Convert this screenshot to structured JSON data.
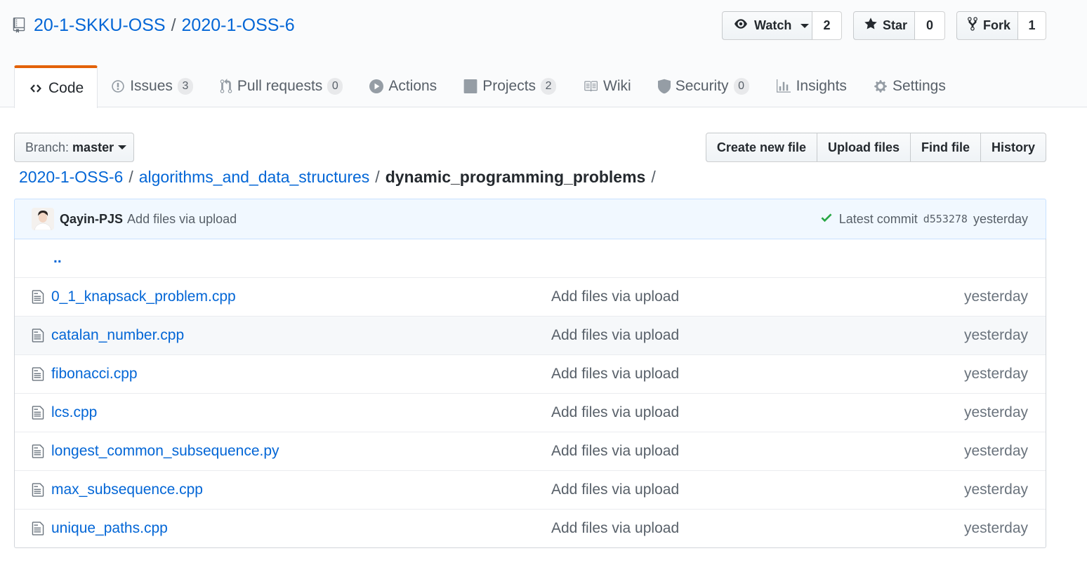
{
  "repo": {
    "owner": "20-1-SKKU-OSS",
    "separator": "/",
    "name": "2020-1-OSS-6"
  },
  "actions": {
    "watch": {
      "label": "Watch",
      "count": "2"
    },
    "star": {
      "label": "Star",
      "count": "0"
    },
    "fork": {
      "label": "Fork",
      "count": "1"
    }
  },
  "nav": {
    "code": {
      "label": "Code"
    },
    "issues": {
      "label": "Issues",
      "count": "3"
    },
    "pulls": {
      "label": "Pull requests",
      "count": "0"
    },
    "actions": {
      "label": "Actions"
    },
    "projects": {
      "label": "Projects",
      "count": "2"
    },
    "wiki": {
      "label": "Wiki"
    },
    "security": {
      "label": "Security",
      "count": "0"
    },
    "insights": {
      "label": "Insights"
    },
    "settings": {
      "label": "Settings"
    }
  },
  "branch": {
    "prefix": "Branch:",
    "name": "master"
  },
  "file_buttons": {
    "create": "Create new file",
    "upload": "Upload files",
    "find": "Find file",
    "history": "History"
  },
  "breadcrumb": {
    "root": "2020-1-OSS-6",
    "dir1": "algorithms_and_data_structures",
    "current": "dynamic_programming_problems",
    "sep": "/"
  },
  "commit": {
    "author": "Qayin-PJS",
    "message": "Add files via upload",
    "latest_label": "Latest commit",
    "sha": "d553278",
    "age": "yesterday"
  },
  "files": {
    "parent": "..",
    "rows": [
      {
        "name": "0_1_knapsack_problem.cpp",
        "message": "Add files via upload",
        "age": "yesterday"
      },
      {
        "name": "catalan_number.cpp",
        "message": "Add files via upload",
        "age": "yesterday"
      },
      {
        "name": "fibonacci.cpp",
        "message": "Add files via upload",
        "age": "yesterday"
      },
      {
        "name": "lcs.cpp",
        "message": "Add files via upload",
        "age": "yesterday"
      },
      {
        "name": "longest_common_subsequence.py",
        "message": "Add files via upload",
        "age": "yesterday"
      },
      {
        "name": "max_subsequence.cpp",
        "message": "Add files via upload",
        "age": "yesterday"
      },
      {
        "name": "unique_paths.cpp",
        "message": "Add files via upload",
        "age": "yesterday"
      }
    ]
  },
  "colors": {
    "link": "#0366d6",
    "muted": "#586069",
    "accent": "#e36209",
    "success": "#28a745"
  }
}
